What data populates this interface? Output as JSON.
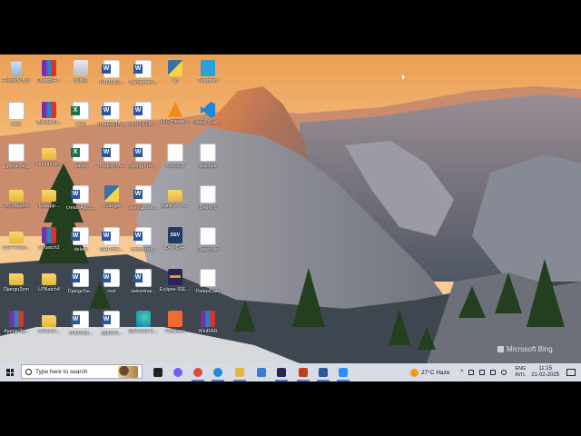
{
  "desktop": {
    "icons": [
      {
        "label": "Recycle Bin",
        "type": "recycle"
      },
      {
        "label": "DjangoR...",
        "type": "rar"
      },
      {
        "label": "dairy1",
        "type": "chrome-sc"
      },
      {
        "label": "HTMLCo...",
        "type": "word"
      },
      {
        "label": "Semestern...",
        "type": "word"
      },
      {
        "label": "eg",
        "type": "py"
      },
      {
        "label": "Telegram",
        "type": "tg"
      },
      {
        "label": "idea",
        "type": "file"
      },
      {
        "label": "DjangoBl...",
        "type": "rar"
      },
      {
        "label": "emp",
        "type": "excel"
      },
      {
        "label": "INHERITA...",
        "type": "word"
      },
      {
        "label": "SPRING BOOT CO...",
        "type": "word"
      },
      {
        "label": "VLC media player",
        "type": "vlc"
      },
      {
        "label": "Visual Studio Code",
        "type": "vs"
      },
      {
        "label": "_pycache_",
        "type": "file"
      },
      {
        "label": "Lecture pr...",
        "type": "folder"
      },
      {
        "label": "sales",
        "type": "excel"
      },
      {
        "label": "INHERITA...",
        "type": "word"
      },
      {
        "label": "Spring Framework",
        "type": "word"
      },
      {
        "label": "WinSCP",
        "type": "file"
      },
      {
        "label": "practice",
        "type": "file"
      },
      {
        "label": "3D Objects",
        "type": "folder"
      },
      {
        "label": "testapp...",
        "type": "folder"
      },
      {
        "label": "createAWS...",
        "type": "word"
      },
      {
        "label": "Triangle",
        "type": "py"
      },
      {
        "label": "springboot...",
        "type": "word"
      },
      {
        "label": "practice - Shortcut",
        "type": "folder"
      },
      {
        "label": "Demo.c",
        "type": "file"
      },
      {
        "label": "CCP Pract...",
        "type": "folder"
      },
      {
        "label": "LPbatch3",
        "type": "rar"
      },
      {
        "label": "delete",
        "type": "word"
      },
      {
        "label": "MAPinte...",
        "type": "word"
      },
      {
        "label": "introducti...",
        "type": "word"
      },
      {
        "label": "Dev-C++",
        "type": "dev"
      },
      {
        "label": "Open-file",
        "type": "file"
      },
      {
        "label": "Django2pm",
        "type": "folder"
      },
      {
        "label": "LPBatch4",
        "type": "folder"
      },
      {
        "label": "DjangoSe...",
        "type": "word"
      },
      {
        "label": "rest",
        "type": "word"
      },
      {
        "label": "swiontrav...",
        "type": "word"
      },
      {
        "label": "Eclipse IDE for Enterpri...",
        "type": "ecl"
      },
      {
        "label": "PadasDate",
        "type": "file"
      },
      {
        "label": "Ajango3p...",
        "type": "rar"
      },
      {
        "label": "Lecturer...",
        "type": "folder"
      },
      {
        "label": "DocRest...",
        "type": "word"
      },
      {
        "label": "pythonl...",
        "type": "word"
      },
      {
        "label": "Microsoft Edge",
        "type": "edge"
      },
      {
        "label": "Postman",
        "type": "post"
      },
      {
        "label": "WinRAR",
        "type": "rar"
      }
    ],
    "watermark": "Microsoft Bing"
  },
  "taskbar": {
    "search_placeholder": "Type here to search",
    "pinned": [
      {
        "name": "task-view",
        "color": "#222222"
      },
      {
        "name": "copilot",
        "color": "#7a5cf0"
      },
      {
        "name": "chrome",
        "color": "#e04a3b"
      },
      {
        "name": "edge",
        "color": "#1f8bd6"
      },
      {
        "name": "file-explorer",
        "color": "#e8b53a"
      },
      {
        "name": "store",
        "color": "#3b7bd8"
      },
      {
        "name": "eclipse",
        "color": "#2c2255"
      },
      {
        "name": "powerpoint",
        "color": "#c43e1c"
      },
      {
        "name": "word",
        "color": "#2b579a"
      },
      {
        "name": "zoom",
        "color": "#2d8cff"
      }
    ],
    "weather": {
      "temp": "27°C",
      "condition": "Haze"
    },
    "language": {
      "line1": "ENG",
      "line2": "INTL"
    },
    "clock": {
      "time": "11:15",
      "date": "21-02-2025"
    }
  },
  "colors": {
    "sky_top": "#e9a25a",
    "sky_bottom": "#f6c98b",
    "rock": "#8a8c93",
    "shadow": "#2f3640",
    "tree": "#2a4a24",
    "taskbar": "#d8dce6"
  }
}
